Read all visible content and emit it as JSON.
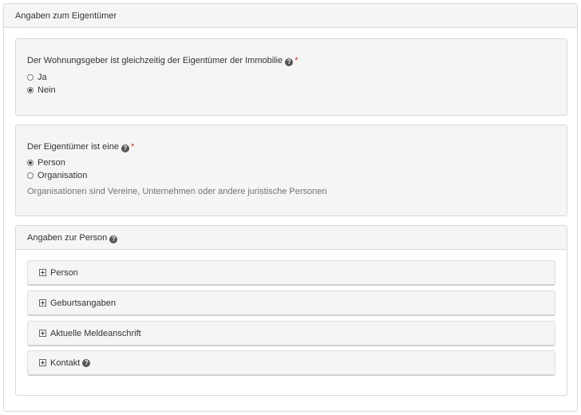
{
  "section": {
    "title": "Angaben zum Eigentümer"
  },
  "question1": {
    "label": "Der Wohnungsgeber ist gleichzeitig der Eigentümer der Immobilie",
    "required_mark": "*",
    "options": [
      {
        "label": "Ja",
        "selected": false
      },
      {
        "label": "Nein",
        "selected": true
      }
    ]
  },
  "question2": {
    "label": "Der Eigentümer ist eine",
    "required_mark": "*",
    "options": [
      {
        "label": "Person",
        "selected": true
      },
      {
        "label": "Organisation",
        "selected": false
      }
    ],
    "hint": "Organisationen sind Vereine, Unternehmen oder andere juristische Personen"
  },
  "person_panel": {
    "title": "Angaben zur Person",
    "accordions": [
      {
        "label": "Person",
        "has_help": false
      },
      {
        "label": "Geburtsangaben",
        "has_help": false
      },
      {
        "label": "Aktuelle Meldeanschrift",
        "has_help": false
      },
      {
        "label": "Kontakt",
        "has_help": true
      }
    ]
  },
  "icons": {
    "help": "question-circle-icon",
    "expand": "plus-square-icon"
  },
  "colors": {
    "required": "#c9302c",
    "well_background": "#f5f5f5",
    "hint_text": "#737373"
  }
}
